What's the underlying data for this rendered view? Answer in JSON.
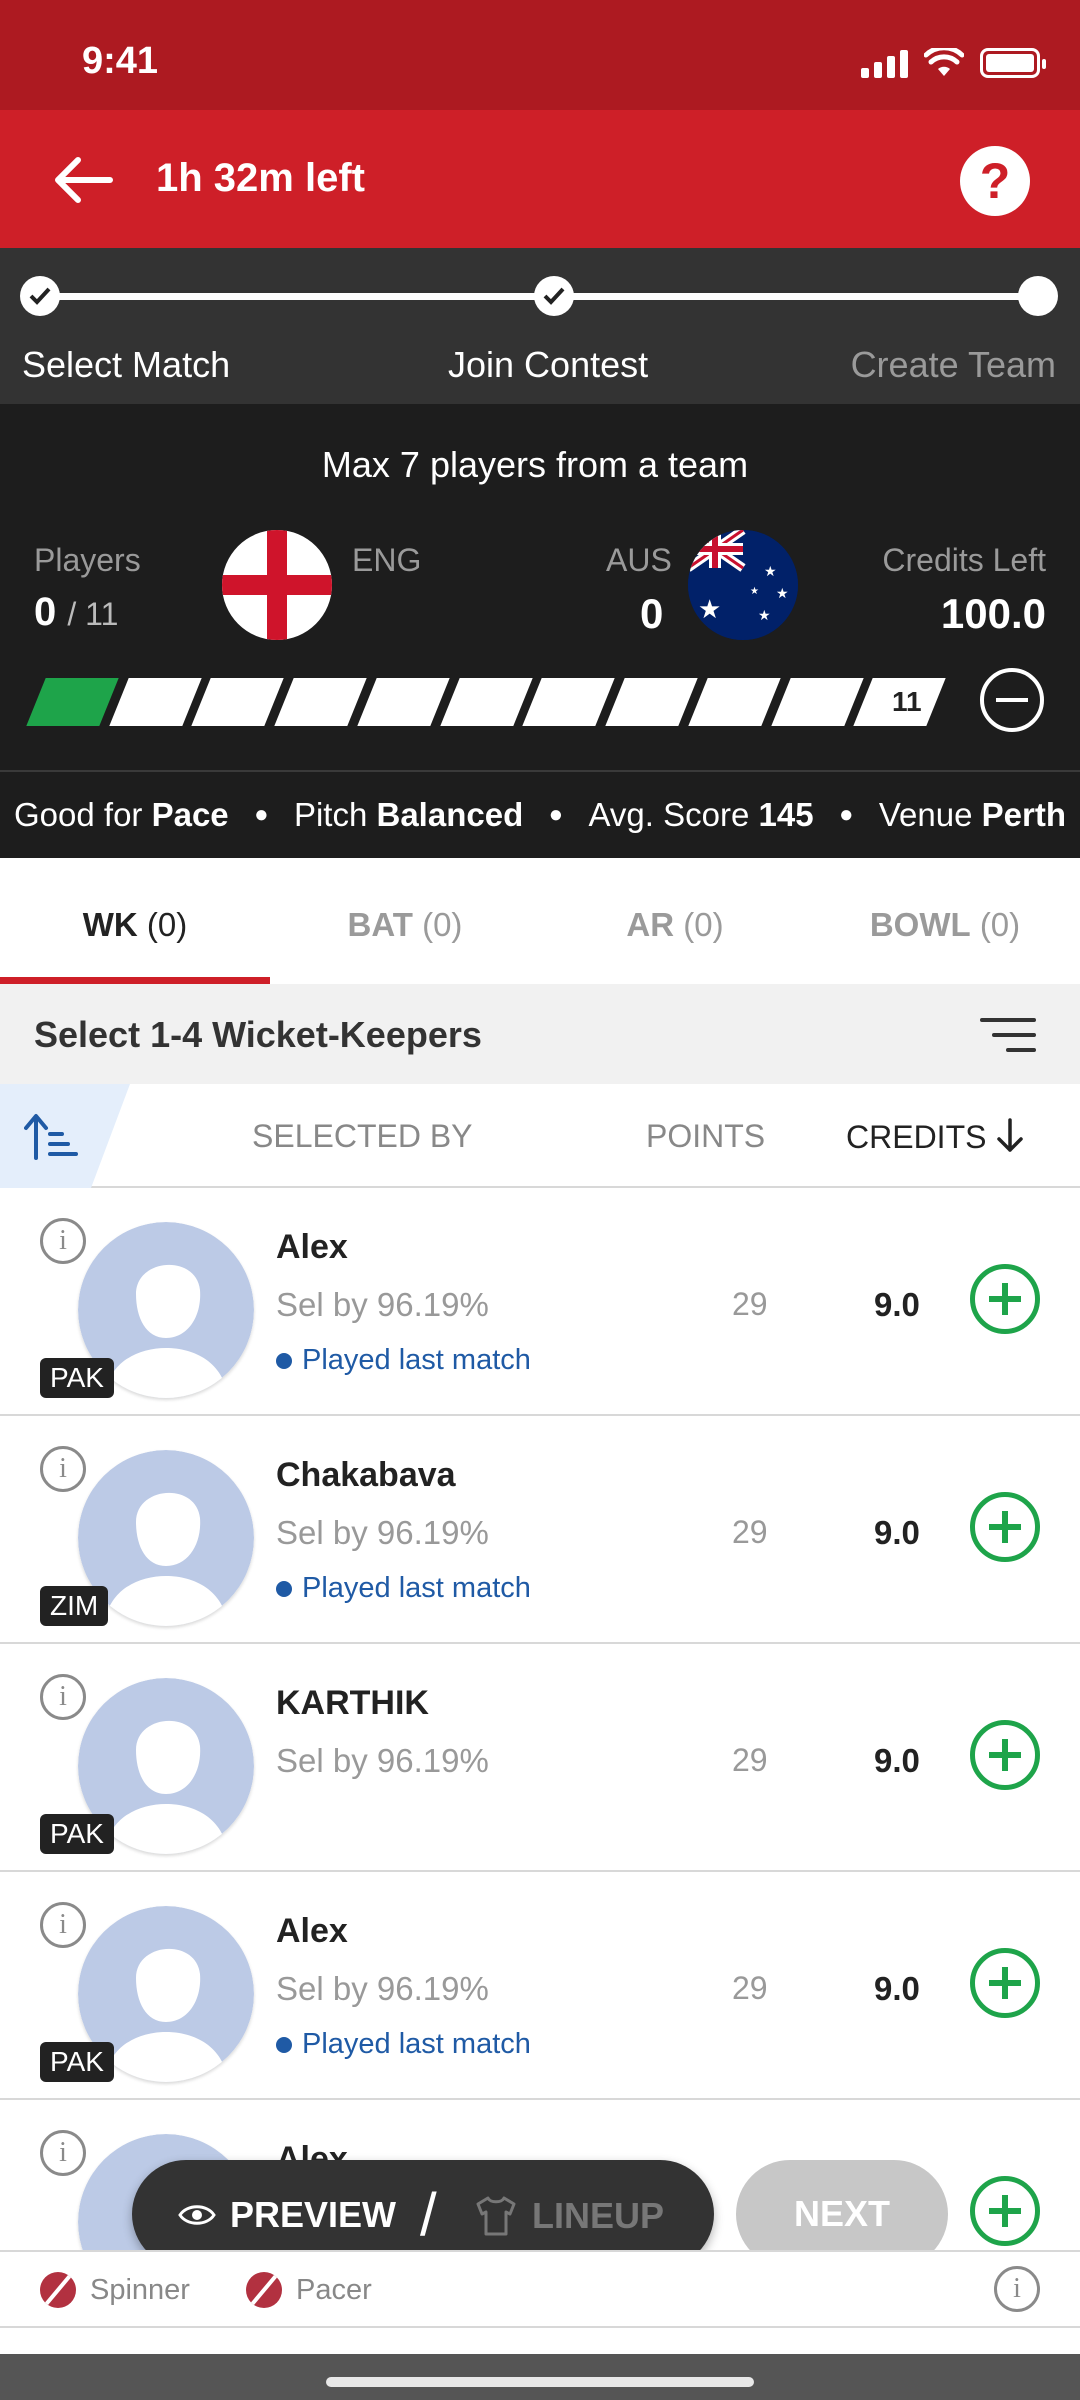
{
  "status": {
    "time": "9:41"
  },
  "header": {
    "title": "1h 32m left",
    "help": "?"
  },
  "steps": [
    {
      "label": "Select Match",
      "done": true
    },
    {
      "label": "Join Contest",
      "done": true
    },
    {
      "label": "Create Team",
      "done": false
    }
  ],
  "team": {
    "max_text": "Max 7 players from a team",
    "players_label": "Players",
    "players_count": "0",
    "players_total": "/ 11",
    "team1": "ENG",
    "team2": "AUS",
    "team2_count": "0",
    "credits_label": "Credits Left",
    "credits": "100.0",
    "slot_last": "11"
  },
  "pitch": {
    "good_for_label": "Good for",
    "good_for": "Pace",
    "pitch_label": "Pitch",
    "pitch": "Balanced",
    "avg_label": "Avg. Score",
    "avg": "145",
    "venue_label": "Venue",
    "venue": "Perth"
  },
  "tabs": [
    {
      "label": "WK",
      "count": "(0)"
    },
    {
      "label": "BAT",
      "count": "(0)"
    },
    {
      "label": "AR",
      "count": "(0)"
    },
    {
      "label": "BOWL",
      "count": "(0)"
    }
  ],
  "select_text": "Select 1-4 Wicket-Keepers",
  "columns": {
    "selected_by": "SELECTED BY",
    "points": "POINTS",
    "credits": "CREDITS"
  },
  "players": [
    {
      "name": "Alex",
      "team": "PAK",
      "sel": "Sel by 96.19%",
      "played": "Played last match",
      "points": "29",
      "credits": "9.0"
    },
    {
      "name": "Chakabava",
      "team": "ZIM",
      "sel": "Sel by 96.19%",
      "played": "Played last match",
      "points": "29",
      "credits": "9.0"
    },
    {
      "name": "KARTHIK",
      "team": "PAK",
      "sel": "Sel by 96.19%",
      "played": "",
      "points": "29",
      "credits": "9.0"
    },
    {
      "name": "Alex",
      "team": "PAK",
      "sel": "Sel by 96.19%",
      "played": "Played last match",
      "points": "29",
      "credits": "9.0"
    },
    {
      "name": "Alex",
      "team": "",
      "sel": "",
      "played": "",
      "points": "",
      "credits": ""
    }
  ],
  "actions": {
    "preview": "PREVIEW",
    "lineup": "LINEUP",
    "next": "NEXT"
  },
  "legend": {
    "spinner": "Spinner",
    "pacer": "Pacer"
  }
}
